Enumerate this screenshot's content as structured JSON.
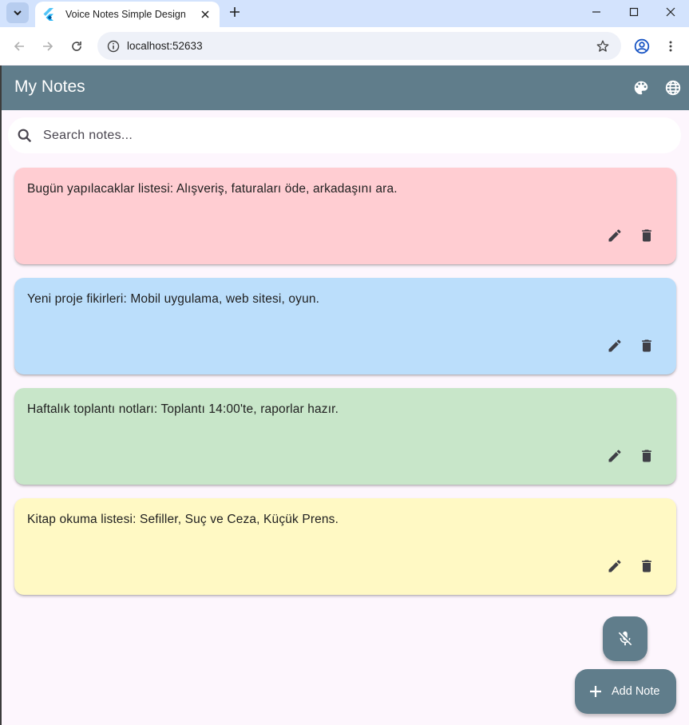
{
  "browser": {
    "tab_title": "Voice Notes Simple Design",
    "url": "localhost:52633"
  },
  "app": {
    "title": "My Notes",
    "search_placeholder": "Search notes...",
    "add_note_label": "Add Note",
    "primary_color": "#607d8b"
  },
  "notes": [
    {
      "text": "Bugün yapılacaklar listesi: Alışveriş, faturaları öde, arkadaşını ara.",
      "color": "#ffcdd2"
    },
    {
      "text": "Yeni proje fikirleri: Mobil uygulama, web sitesi, oyun.",
      "color": "#bbdefb"
    },
    {
      "text": "Haftalık toplantı notları: Toplantı 14:00'te, raporlar hazır.",
      "color": "#c8e6c9"
    },
    {
      "text": "Kitap okuma listesi: Sefiller, Suç ve Ceza, Küçük Prens.",
      "color": "#fff9c4"
    }
  ],
  "icons": {
    "tab_menu": "chevron-down-icon",
    "favicon": "flutter-icon",
    "tab_close": "close-icon",
    "new_tab": "plus-icon",
    "back": "arrow-left-icon",
    "forward": "arrow-right-icon",
    "reload": "reload-icon",
    "site_info": "tune-icon",
    "bookmark": "star-icon",
    "profile": "account-icon",
    "menu": "more-vert-icon",
    "palette": "palette-icon",
    "language": "globe-icon",
    "search": "search-icon",
    "edit": "pencil-icon",
    "delete": "trash-icon",
    "mic_off": "mic-off-icon",
    "add": "plus-icon"
  }
}
